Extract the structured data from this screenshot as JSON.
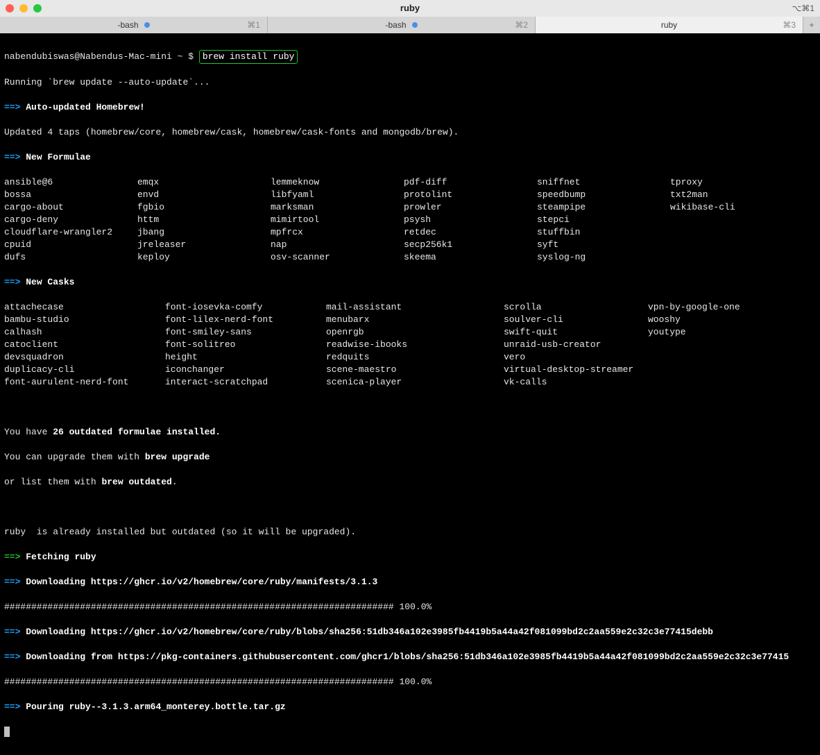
{
  "titlebar": {
    "title": "ruby",
    "right_shortcut": "⌥⌘1"
  },
  "tabs": {
    "items": [
      {
        "label": "-bash",
        "has_dot": true,
        "shortcut": "⌘1",
        "active": false
      },
      {
        "label": "-bash",
        "has_dot": true,
        "shortcut": "⌘2",
        "active": false
      },
      {
        "label": "ruby",
        "has_dot": false,
        "shortcut": "⌘3",
        "active": true
      }
    ],
    "plus": "+"
  },
  "prompt": {
    "path": "nabendubiswas@Nabendus-Mac-mini ~ $ ",
    "command": "brew install ruby"
  },
  "arrow_sym": "==>",
  "lines": {
    "running": "Running `brew update --auto-update`...",
    "auto_update": "Auto-updated Homebrew!",
    "updated_taps": "Updated 4 taps (homebrew/core, homebrew/cask, homebrew/cask-fonts and mongodb/brew).",
    "new_formulae": "New Formulae",
    "new_casks": "New Casks"
  },
  "formulae": [
    [
      "ansible@6",
      "emqx",
      "lemmeknow",
      "pdf-diff",
      "sniffnet",
      "tproxy"
    ],
    [
      "bossa",
      "envd",
      "libfyaml",
      "protolint",
      "speedbump",
      "txt2man"
    ],
    [
      "cargo-about",
      "fgbio",
      "marksman",
      "prowler",
      "steampipe",
      "wikibase-cli"
    ],
    [
      "cargo-deny",
      "httm",
      "mimirtool",
      "psysh",
      "stepci",
      ""
    ],
    [
      "cloudflare-wrangler2",
      "jbang",
      "mpfrcx",
      "retdec",
      "stuffbin",
      ""
    ],
    [
      "cpuid",
      "jreleaser",
      "nap",
      "secp256k1",
      "syft",
      ""
    ],
    [
      "dufs",
      "keploy",
      "osv-scanner",
      "skeema",
      "syslog-ng",
      ""
    ]
  ],
  "casks": [
    [
      "attachecase",
      "font-iosevka-comfy",
      "mail-assistant",
      "scrolla",
      "vpn-by-google-one"
    ],
    [
      "bambu-studio",
      "font-lilex-nerd-font",
      "menubarx",
      "soulver-cli",
      "wooshy"
    ],
    [
      "calhash",
      "font-smiley-sans",
      "openrgb",
      "swift-quit",
      "youtype"
    ],
    [
      "catoclient",
      "font-solitreo",
      "readwise-ibooks",
      "unraid-usb-creator",
      ""
    ],
    [
      "devsquadron",
      "height",
      "redquits",
      "vero",
      ""
    ],
    [
      "duplicacy-cli",
      "iconchanger",
      "scene-maestro",
      "virtual-desktop-streamer",
      ""
    ],
    [
      "font-aurulent-nerd-font",
      "interact-scratchpad",
      "scenica-player",
      "vk-calls",
      ""
    ]
  ],
  "outdated": {
    "l1a": "You have ",
    "l1b": "26 outdated formulae installed.",
    "l2a": "You can upgrade them with ",
    "l2b": "brew upgrade",
    "l3a": "or list them with ",
    "l3b": "brew outdated",
    "l3c": "."
  },
  "already": "ruby  is already installed but outdated (so it will be upgraded).",
  "fetch": {
    "label": "Fetching ",
    "pkg": "ruby"
  },
  "dl1": "Downloading https://ghcr.io/v2/homebrew/core/ruby/manifests/3.1.3",
  "hashbar": "######################################################################## 100.0%",
  "dl2": "Downloading https://ghcr.io/v2/homebrew/core/ruby/blobs/sha256:51db346a102e3985fb4419b5a44a42f081099bd2c2aa559e2c32c3e77415debb",
  "dl3": "Downloading from https://pkg-containers.githubusercontent.com/ghcr1/blobs/sha256:51db346a102e3985fb4419b5a44a42f081099bd2c2aa559e2c32c3e77415",
  "pour": "Pouring ruby--3.1.3.arm64_monterey.bottle.tar.gz"
}
